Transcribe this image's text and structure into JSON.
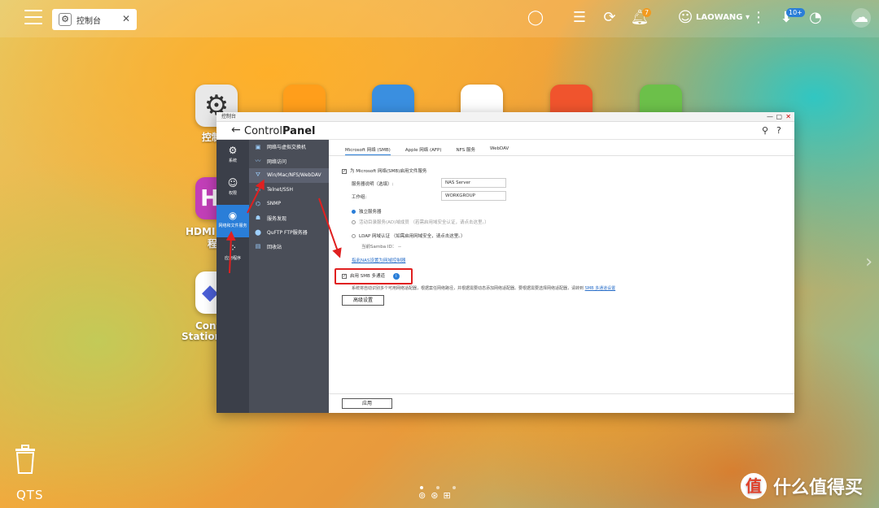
{
  "taskbar": {
    "tab_label": "控制台",
    "notification_count": "7",
    "update_badge": "10+",
    "user_name": "LAOWANG ▾"
  },
  "desktop": {
    "icon_labels": {
      "control_panel_partial": "控制",
      "hdmi_partial_1": "HDMI 显",
      "hdmi_partial_2": "程",
      "contact_partial_1": "Cont",
      "contact_partial_2": "Station"
    }
  },
  "window": {
    "titlebar": "控制台",
    "title_light": "Control",
    "title_bold": "Panel",
    "nav_primary": [
      {
        "label": "系统",
        "icon": "gear-icon"
      },
      {
        "label": "权限",
        "icon": "user-icon"
      },
      {
        "label": "网络和文件服务",
        "icon": "network-icon",
        "active": true
      },
      {
        "label": "应用程序",
        "icon": "apps-icon"
      }
    ],
    "nav_secondary": [
      {
        "label": "网络与虚拟交换机",
        "icon": "switch-icon"
      },
      {
        "label": "网络访问",
        "icon": "network-access-icon"
      },
      {
        "label": "Win/Mac/NFS/WebDAV",
        "icon": "folders-icon",
        "active": true
      },
      {
        "label": "Telnet/SSH",
        "icon": "terminal-icon"
      },
      {
        "label": "SNMP",
        "icon": "snmp-icon"
      },
      {
        "label": "服务发现",
        "icon": "discovery-icon"
      },
      {
        "label": "QuFTP FTP服务器",
        "icon": "ftp-icon"
      },
      {
        "label": "回收站",
        "icon": "recycle-icon"
      }
    ],
    "tabs": [
      "Microsoft 网络 (SMB)",
      "Apple 网络 (AFP)",
      "NFS 服务",
      "WebDAV"
    ],
    "smb": {
      "enable_label": "为 Microsoft 网络(SMB)启用文件服务",
      "server_desc_label": "服务器说明（选填）:",
      "server_desc_value": "NAS Server",
      "workgroup_label": "工作组:",
      "workgroup_value": "WORKGROUP",
      "standalone": "独立服务器",
      "ad_member": "活动目录服务(AD)域成员 （若需启用域安全认证，请点击这里。）",
      "ldap": "LDAP 网域认证 （如需启用网域安全，请点击这里。）",
      "samba_id_label": "当前Samba ID：",
      "samba_id_value": "--",
      "domain_controller_link": "指此NAS设置为网域控制器",
      "multichannel_label": "启用 SMB 多通道",
      "multichannel_desc": "系统将自动识别多个可用网络适配器，根据案任网络路径，并根据需要动态添加网络适配器。要根据需要选择网络适配器，请转到",
      "multichannel_link": "SMB 多通道设置",
      "advanced_button": "高级设置",
      "apply_button": "应用"
    }
  },
  "bottom": {
    "qts_label": "QTS",
    "watermark": "什么值得买",
    "watermark_logo": "值"
  },
  "colors": {
    "accent": "#2a7ed8",
    "highlight": "#e02020",
    "nav_dark": "#3b3f49"
  }
}
